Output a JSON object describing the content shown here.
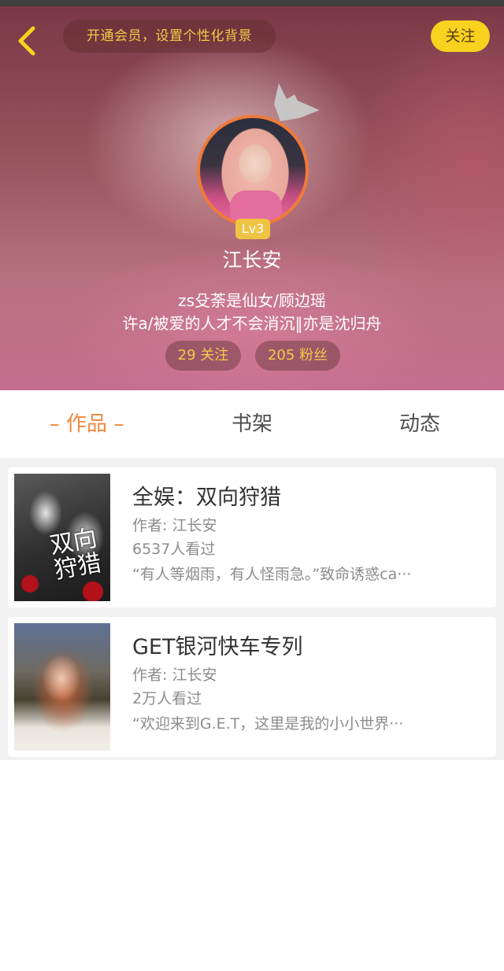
{
  "header": {
    "vip_prompt": "开通会员，设置个性化背景",
    "follow_label": "关注",
    "level": "Lv3",
    "nickname": "江长安",
    "bio_line1": "zs殳荼是仙女/顾边瑶",
    "bio_line2": "许a/被爱的人才不会消沉‖亦是沈归舟",
    "following": "29 关注",
    "followers": "205 粉丝"
  },
  "tabs": [
    {
      "label": "– 作品 –",
      "active": true
    },
    {
      "label": "书架",
      "active": false
    },
    {
      "label": "动态",
      "active": false
    }
  ],
  "books": [
    {
      "title": "全娱：双向狩猎",
      "cover_text": "双向狩猎",
      "author": "作者: 江长安",
      "views": "6537人看过",
      "description": "“有人等烟雨，有人怪雨急。”致命诱惑ca···"
    },
    {
      "title": "GET银河快车专列",
      "author": "作者: 江长安",
      "views": "2万人看过",
      "description": "“欢迎来到G.E.T，这里是我的小小世界···"
    }
  ],
  "colors": {
    "accent_orange": "#f0873d",
    "follow_yellow": "#f8d21e",
    "gold_text": "#f3c94a"
  }
}
